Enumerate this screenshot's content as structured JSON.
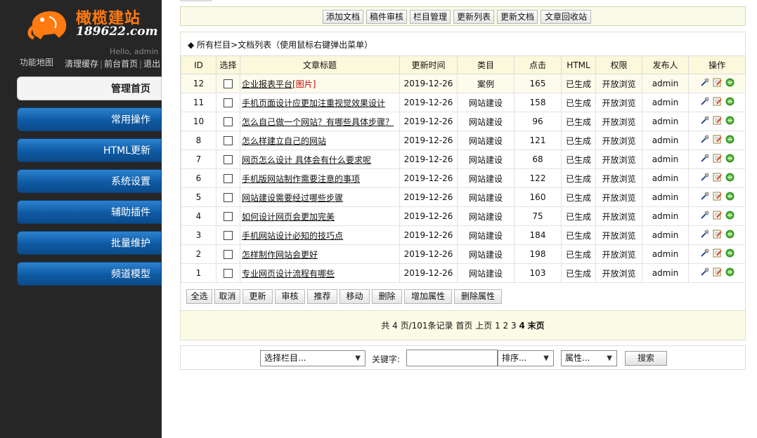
{
  "logo": {
    "brand": "橄榄建站",
    "domain": "189622.com"
  },
  "sidebar": {
    "hello": "Hello, admin",
    "sitemap": "功能地图",
    "links": [
      "清理缓存",
      "前台首页",
      "退出"
    ],
    "menu": [
      "管理首页",
      "常用操作",
      "HTML更新",
      "系统设置",
      "辅助插件",
      "批量维护",
      "频道模型"
    ]
  },
  "toolbar": [
    "添加文档",
    "稿件审核",
    "栏目管理",
    "更新列表",
    "更新文档",
    "文章回收站"
  ],
  "list": {
    "title": "所有栏目>文档列表（使用鼠标右键弹出菜单）",
    "headers": [
      "ID",
      "选择",
      "文章标题",
      "更新时间",
      "类目",
      "点击",
      "HTML",
      "权限",
      "发布人",
      "操作"
    ],
    "pic_tag": "[图片]",
    "rows": [
      {
        "id": "12",
        "title": "企业报表平台",
        "pic": true,
        "date": "2019-12-26",
        "cat": "案例",
        "clicks": "165",
        "html": "已生成",
        "perm": "开放浏览",
        "author": "admin"
      },
      {
        "id": "11",
        "title": "手机页面设计应更加注重视觉效果设计",
        "pic": false,
        "date": "2019-12-26",
        "cat": "网站建设",
        "clicks": "158",
        "html": "已生成",
        "perm": "开放浏览",
        "author": "admin"
      },
      {
        "id": "10",
        "title": "怎么自己做一个网站？有哪些具体步骤？",
        "pic": false,
        "date": "2019-12-26",
        "cat": "网站建设",
        "clicks": "96",
        "html": "已生成",
        "perm": "开放浏览",
        "author": "admin"
      },
      {
        "id": "8",
        "title": "怎么样建立自己的网站",
        "pic": false,
        "date": "2019-12-26",
        "cat": "网站建设",
        "clicks": "121",
        "html": "已生成",
        "perm": "开放浏览",
        "author": "admin"
      },
      {
        "id": "7",
        "title": "网页怎么设计 具体会有什么要求呢",
        "pic": false,
        "date": "2019-12-26",
        "cat": "网站建设",
        "clicks": "68",
        "html": "已生成",
        "perm": "开放浏览",
        "author": "admin"
      },
      {
        "id": "6",
        "title": "手机版网站制作需要注意的事项",
        "pic": false,
        "date": "2019-12-26",
        "cat": "网站建设",
        "clicks": "122",
        "html": "已生成",
        "perm": "开放浏览",
        "author": "admin"
      },
      {
        "id": "5",
        "title": "网站建设需要经过哪些步骤",
        "pic": false,
        "date": "2019-12-26",
        "cat": "网站建设",
        "clicks": "160",
        "html": "已生成",
        "perm": "开放浏览",
        "author": "admin"
      },
      {
        "id": "4",
        "title": "如何设计网页会更加完美",
        "pic": false,
        "date": "2019-12-26",
        "cat": "网站建设",
        "clicks": "75",
        "html": "已生成",
        "perm": "开放浏览",
        "author": "admin"
      },
      {
        "id": "3",
        "title": "手机网站设计必知的技巧点",
        "pic": false,
        "date": "2019-12-26",
        "cat": "网站建设",
        "clicks": "184",
        "html": "已生成",
        "perm": "开放浏览",
        "author": "admin"
      },
      {
        "id": "2",
        "title": "怎样制作网站会更好",
        "pic": false,
        "date": "2019-12-26",
        "cat": "网站建设",
        "clicks": "198",
        "html": "已生成",
        "perm": "开放浏览",
        "author": "admin"
      },
      {
        "id": "1",
        "title": "专业网页设计流程有哪些",
        "pic": false,
        "date": "2019-12-26",
        "cat": "网站建设",
        "clicks": "103",
        "html": "已生成",
        "perm": "开放浏览",
        "author": "admin"
      }
    ],
    "op_icons": [
      "edit-properties-icon",
      "edit-document-icon",
      "preview-icon"
    ]
  },
  "actions": [
    "全选",
    "取消",
    "更新",
    "审核",
    "推荐",
    "移动",
    "删除",
    "增加属性",
    "删除属性"
  ],
  "pager": {
    "summary": "共 4 页/101条记录",
    "first": "首页",
    "prev": "上页",
    "pages": [
      "1",
      "2",
      "3"
    ],
    "current": "4",
    "last": "末页"
  },
  "search": {
    "category": "选择栏目...",
    "keyword_label": "关键字:",
    "keyword_value": "",
    "sort": "排序...",
    "attr": "属性...",
    "button": "搜索"
  },
  "colors": {
    "accent": "#1565b5",
    "logo_orange": "#ff7a10",
    "header_bg": "#fbf8dc",
    "pic_tag": "#cc0000"
  }
}
